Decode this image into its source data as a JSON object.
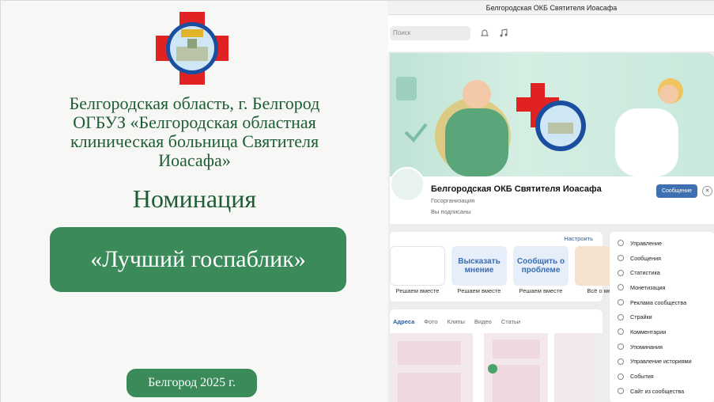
{
  "left": {
    "region_lines": [
      "Белгородская область, г. Белгород",
      "ОГБУЗ «Белгородская областная",
      "клиническая больница Святителя",
      "Иоасафа»"
    ],
    "nomination": "Номинация",
    "award": "«Лучший госпаблик»",
    "city_year": "Белгород 2025 г."
  },
  "window": {
    "title": "Белгородская ОКБ Святителя Иоасафа"
  },
  "topbar": {
    "search_placeholder": "Поиск"
  },
  "profile": {
    "name": "Белгородская ОКБ Святителя Иоасафа",
    "type": "Госорганизация",
    "subscribed": "Вы подписаны",
    "message_button": "Сообщение"
  },
  "feed": {
    "setup": "Настроить",
    "cards": [
      {
        "title": "",
        "caption": "Решаем вместе"
      },
      {
        "title": "Высказать мнение",
        "caption": "Решаем вместе"
      },
      {
        "title": "Сообщить о проблеме",
        "caption": "Решаем вместе"
      },
      {
        "title": "",
        "caption": "Всё о мене"
      }
    ]
  },
  "tabs": [
    "Адреса",
    "Фото",
    "Клипы",
    "Видео",
    "Статьи"
  ],
  "menu": [
    "Управление",
    "Сообщения",
    "Статистика",
    "Монетизация",
    "Реклама сообщества",
    "Страйки",
    "Комментарии",
    "Упоминания",
    "Управление историями",
    "События",
    "Сайт из сообщества"
  ],
  "colors": {
    "accent_green": "#3a8a5a",
    "dark_green": "#1e5c34",
    "vk_blue": "#3f6fb3",
    "cross_red": "#e02222"
  }
}
